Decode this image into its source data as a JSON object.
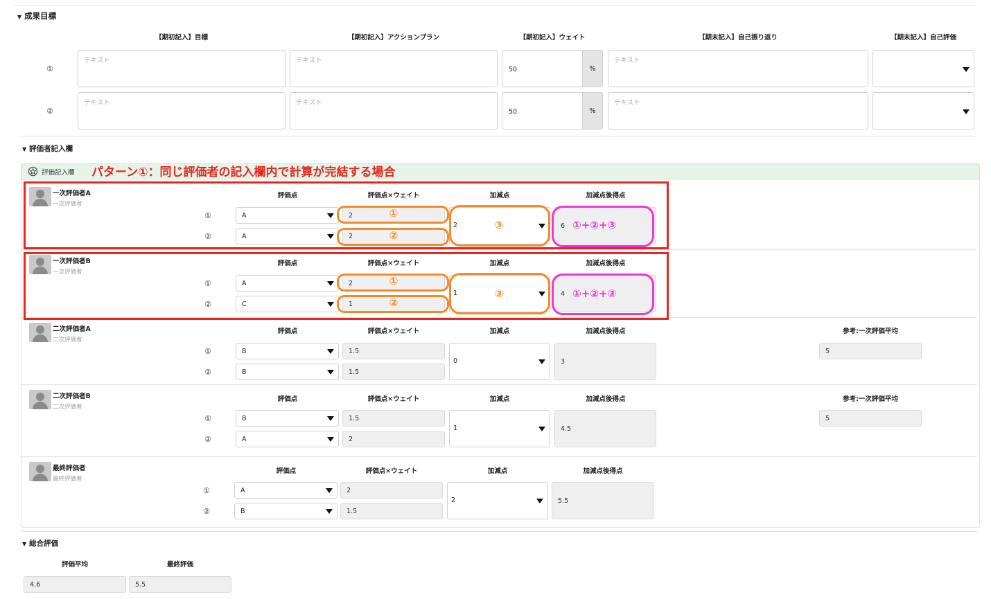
{
  "goals": {
    "title": "成果目標",
    "headers": [
      "【期初記入】目標",
      "【期初記入】アクションプラン",
      "【期初記入】ウェイト",
      "【期末記入】自己振り返り",
      "【期末記入】自己評価"
    ],
    "rows": [
      {
        "num": "①",
        "goal_ph": "テキスト",
        "plan_ph": "テキスト",
        "weight": "50",
        "unit": "%",
        "reflection_ph": "テキスト",
        "self_eval": ""
      },
      {
        "num": "②",
        "goal_ph": "テキスト",
        "plan_ph": "テキスト",
        "weight": "50",
        "unit": "%",
        "reflection_ph": "テキスト",
        "self_eval": ""
      }
    ]
  },
  "evaluator_section": {
    "title": "評価者記入欄",
    "panel_label": "評価記入欄",
    "annotation": "パターン①：同じ評価者の記入欄内で計算が完結する場合"
  },
  "evaluators": [
    {
      "name": "一次評価者A",
      "role": "一次評価者",
      "headers": [
        "評価点",
        "評価点×ウェイト",
        "加減点",
        "加減点後得点"
      ],
      "rows": [
        {
          "num": "①",
          "score": "A",
          "weighted": "2"
        },
        {
          "num": "②",
          "score": "A",
          "weighted": "2"
        }
      ],
      "adjust": "2",
      "after": "6"
    },
    {
      "name": "一次評価者B",
      "role": "一次評価者",
      "headers": [
        "評価点",
        "評価点×ウェイト",
        "加減点",
        "加減点後得点"
      ],
      "rows": [
        {
          "num": "①",
          "score": "A",
          "weighted": "2"
        },
        {
          "num": "②",
          "score": "C",
          "weighted": "1"
        }
      ],
      "adjust": "1",
      "after": "4"
    },
    {
      "name": "二次評価者A",
      "role": "二次評価者",
      "headers": [
        "評価点",
        "評価点×ウェイト",
        "加減点",
        "加減点後得点"
      ],
      "ref_header": "参考:一次評価平均",
      "ref_value": "5",
      "rows": [
        {
          "num": "①",
          "score": "B",
          "weighted": "1.5"
        },
        {
          "num": "②",
          "score": "B",
          "weighted": "1.5"
        }
      ],
      "adjust": "0",
      "after": "3"
    },
    {
      "name": "二次評価者B",
      "role": "二次評価者",
      "headers": [
        "評価点",
        "評価点×ウェイト",
        "加減点",
        "加減点後得点"
      ],
      "ref_header": "参考:一次評価平均",
      "ref_value": "5",
      "rows": [
        {
          "num": "①",
          "score": "B",
          "weighted": "1.5"
        },
        {
          "num": "②",
          "score": "A",
          "weighted": "2"
        }
      ],
      "adjust": "1",
      "after": "4.5"
    },
    {
      "name": "最終評価者",
      "role": "最終評価者",
      "headers": [
        "評価点",
        "評価点×ウェイト",
        "加減点",
        "加減点後得点"
      ],
      "rows": [
        {
          "num": "①",
          "score": "A",
          "weighted": "2"
        },
        {
          "num": "②",
          "score": "B",
          "weighted": "1.5"
        }
      ],
      "adjust": "2",
      "after": "5.5"
    }
  ],
  "annotations": {
    "c1": "①",
    "c2": "②",
    "c3": "③",
    "formula": "①+②+③"
  },
  "overall": {
    "title": "総合評価",
    "avg_label": "評価平均",
    "avg_value": "4.6",
    "final_label": "最終評価",
    "final_value": "5.5"
  },
  "colors": {
    "red": "#e8261f",
    "orange": "#f58a2a",
    "pink": "#ee35d9",
    "green_bar": "#e5f3e8"
  }
}
